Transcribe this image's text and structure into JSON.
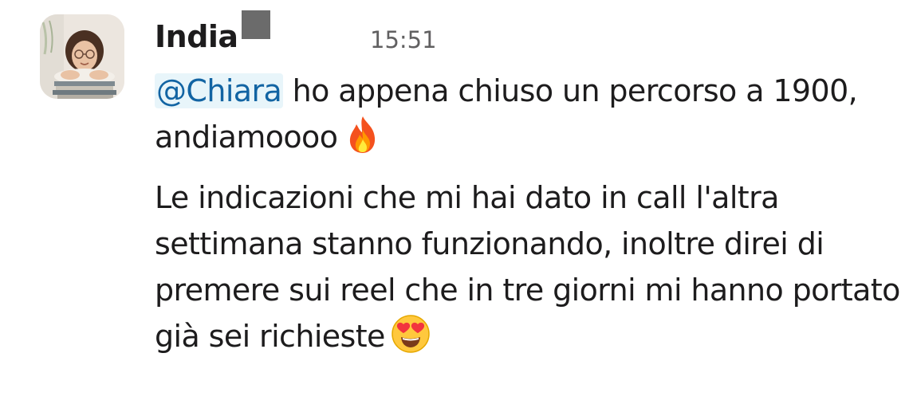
{
  "message": {
    "sender": "India",
    "timestamp": "15:51",
    "avatar_icon": "profile-photo",
    "status_color": "#6b6b6b",
    "paragraphs": [
      {
        "mention": "@Chiara",
        "text": " ho appena chiuso un percorso a 1900, andiamoooo",
        "emoji": "fire-emoji"
      },
      {
        "text": "Le indicazioni che mi hai dato in call l'altra settimana stanno funzionando, inoltre direi di premere sui reel che in tre giorni mi hanno portato già sei richieste",
        "emoji": "heart-eyes-emoji"
      }
    ]
  },
  "colors": {
    "text": "#1d1c1d",
    "timestamp": "#616061",
    "mention_text": "#1264a3",
    "mention_bg": "#e8f5fa"
  }
}
